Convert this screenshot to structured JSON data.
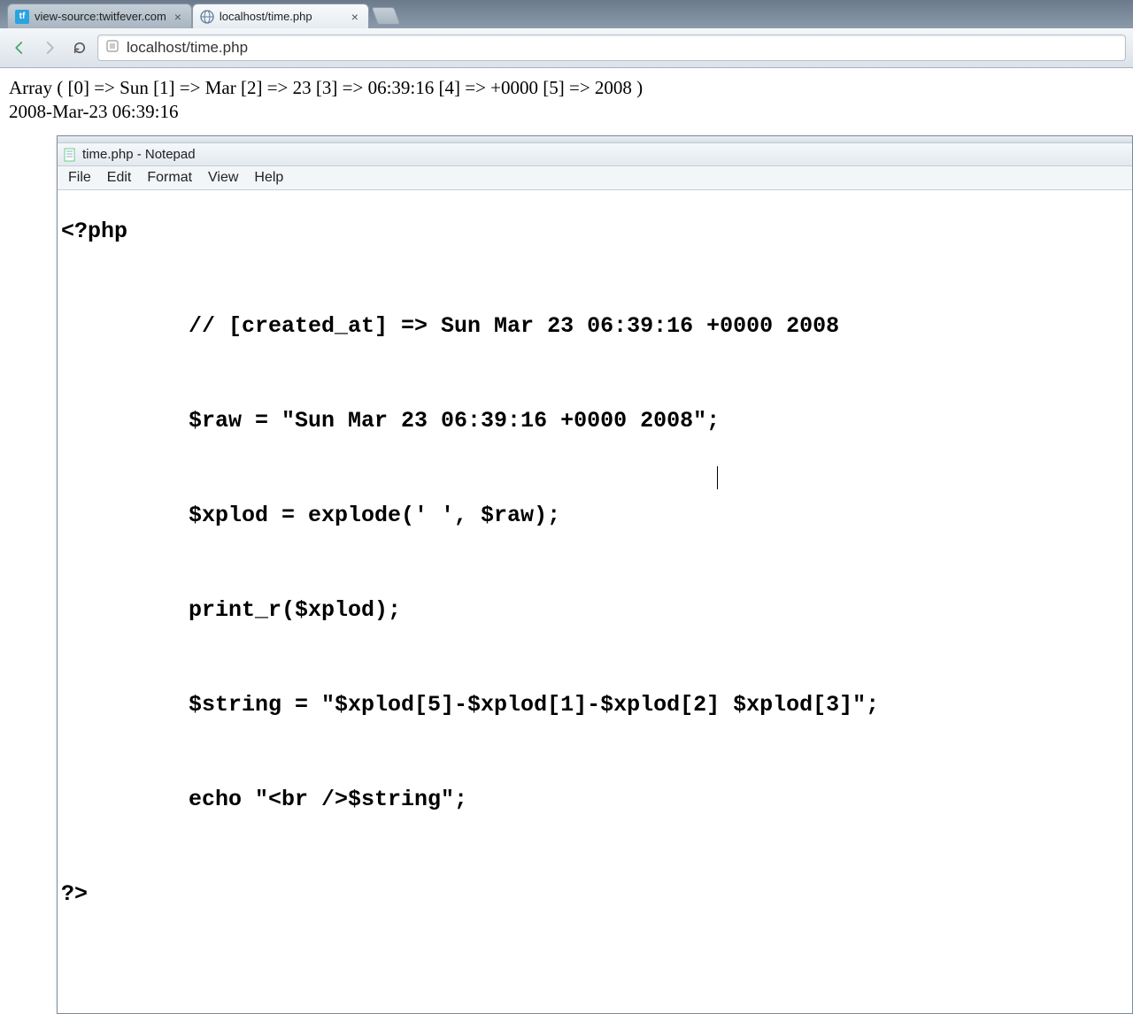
{
  "browser": {
    "tabs": [
      {
        "title": "view-source:twitfever.com",
        "active": false,
        "favicon": "tf"
      },
      {
        "title": "localhost/time.php",
        "active": true,
        "favicon": "globe"
      }
    ],
    "url": "localhost/time.php"
  },
  "page": {
    "line1": "Array ( [0] => Sun [1] => Mar [2] => 23 [3] => 06:39:16 [4] => +0000 [5] => 2008 )",
    "line2": "2008-Mar-23 06:39:16"
  },
  "notepad": {
    "title": "time.php - Notepad",
    "menu": {
      "file": "File",
      "edit": "Edit",
      "format": "Format",
      "view": "View",
      "help": "Help"
    },
    "code": {
      "l1": "<?php",
      "l2": "// [created_at] => Sun Mar 23 06:39:16 +0000 2008",
      "l3": "$raw = \"Sun Mar 23 06:39:16 +0000 2008\";",
      "l4": "$xplod = explode(' ', $raw);",
      "l5": "print_r($xplod);",
      "l6": "$string = \"$xplod[5]-$xplod[1]-$xplod[2] $xplod[3]\";",
      "l7": "echo \"<br />$string\";",
      "l8": "?>"
    }
  }
}
